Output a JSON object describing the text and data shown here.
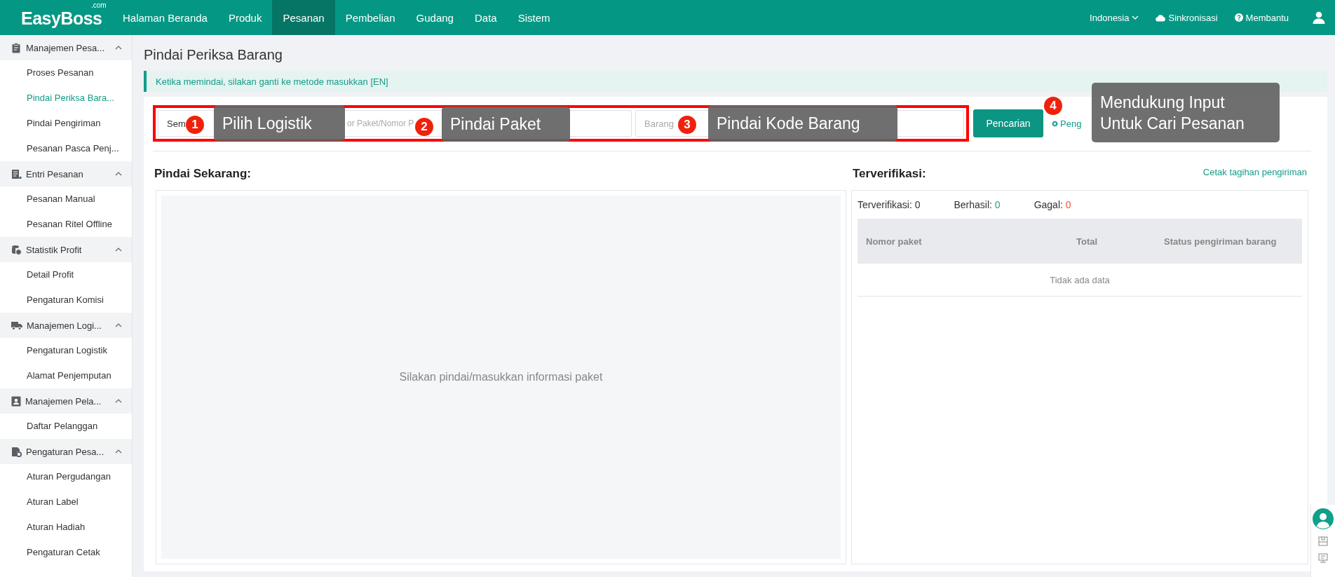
{
  "app": {
    "logo": "EasyBoss",
    "logo_suffix": ".com"
  },
  "nav": [
    {
      "label": "Halaman Beranda",
      "selected": false
    },
    {
      "label": "Produk",
      "selected": false
    },
    {
      "label": "Pesanan",
      "selected": true
    },
    {
      "label": "Pembelian",
      "selected": false
    },
    {
      "label": "Gudang",
      "selected": false
    },
    {
      "label": "Data",
      "selected": false
    },
    {
      "label": "Sistem",
      "selected": false
    }
  ],
  "header_right": {
    "language": "Indonesia",
    "sync": "Sinkronisasi",
    "help": "Membantu"
  },
  "sidebar": [
    {
      "label": "Manajemen Pesa...",
      "expanded": true,
      "children": [
        {
          "label": "Proses Pesanan",
          "selected": false
        },
        {
          "label": "Pindai Periksa Bara...",
          "selected": true
        },
        {
          "label": "Pindai Pengiriman",
          "selected": false
        },
        {
          "label": "Pesanan Pasca Penj...",
          "selected": false
        }
      ]
    },
    {
      "label": "Entri Pesanan",
      "expanded": true,
      "children": [
        {
          "label": "Pesanan Manual",
          "selected": false
        },
        {
          "label": "Pesanan Ritel Offline",
          "selected": false
        }
      ]
    },
    {
      "label": "Statistik Profit",
      "expanded": true,
      "children": [
        {
          "label": "Detail Profit",
          "selected": false
        },
        {
          "label": "Pengaturan Komisi",
          "selected": false
        }
      ]
    },
    {
      "label": "Manajemen Logi...",
      "expanded": true,
      "children": [
        {
          "label": "Pengaturan Logistik",
          "selected": false
        },
        {
          "label": "Alamat Penjemputan",
          "selected": false
        }
      ]
    },
    {
      "label": "Manajemen Pela...",
      "expanded": true,
      "children": [
        {
          "label": "Daftar Pelanggan",
          "selected": false
        }
      ]
    },
    {
      "label": "Pengaturan Pesa...",
      "expanded": true,
      "children": [
        {
          "label": "Aturan Pergudangan",
          "selected": false
        },
        {
          "label": "Aturan Label",
          "selected": false
        },
        {
          "label": "Aturan Hadiah",
          "selected": false
        },
        {
          "label": "Pengaturan Cetak",
          "selected": false
        }
      ]
    }
  ],
  "page": {
    "title": "Pindai Periksa Barang",
    "notice": "Ketika memindai, silakan ganti ke metode masukkan [EN]"
  },
  "search": {
    "logistics_value": "Sem",
    "package_placeholder": "or Paket/Nomor P",
    "item_placeholder": "Barang",
    "button": "Pencarian",
    "settings_link": "Peng"
  },
  "annotations": [
    {
      "number": "1",
      "text": "Pilih Logistik"
    },
    {
      "number": "2",
      "text": "Pindai Paket"
    },
    {
      "number": "3",
      "text": "Pindai Kode Barang"
    },
    {
      "number": "4",
      "text": "Mendukung Input Untuk Cari Pesanan"
    }
  ],
  "scan_now": {
    "title": "Pindai Sekarang:",
    "empty_text": "Silakan pindai/masukkan informasi paket"
  },
  "verified": {
    "title": "Terverifikasi:",
    "print_link": "Cetak tagihan pengiriman",
    "stats": [
      {
        "label": "Terverifikasi:",
        "value": "0",
        "color": "#333333"
      },
      {
        "label": "Berhasil:",
        "value": "0",
        "color": "#2ba471"
      },
      {
        "label": "Gagal:",
        "value": "0",
        "color": "#f5512c"
      }
    ],
    "table": {
      "columns": [
        "Nomor paket",
        "Total",
        "Status pengiriman barang"
      ],
      "empty_text": "Tidak ada data"
    }
  }
}
